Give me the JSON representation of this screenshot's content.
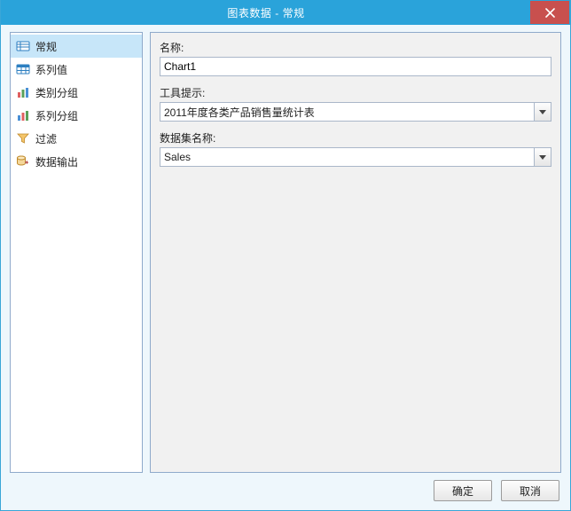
{
  "window": {
    "title": "图表数据 - 常规",
    "close_label": "Close"
  },
  "sidebar": {
    "items": [
      {
        "id": "general",
        "label": "常规",
        "icon": "general-icon",
        "selected": true
      },
      {
        "id": "series-values",
        "label": "系列值",
        "icon": "series-values-icon",
        "selected": false
      },
      {
        "id": "category-groups",
        "label": "类别分组",
        "icon": "category-groups-icon",
        "selected": false
      },
      {
        "id": "series-groups",
        "label": "系列分组",
        "icon": "series-groups-icon",
        "selected": false
      },
      {
        "id": "filters",
        "label": "过滤",
        "icon": "filter-icon",
        "selected": false
      },
      {
        "id": "data-output",
        "label": "数据输出",
        "icon": "data-output-icon",
        "selected": false
      }
    ]
  },
  "main": {
    "name": {
      "label": "名称:",
      "value": "Chart1"
    },
    "tooltip": {
      "label": "工具提示:",
      "value": "2011年度各类产品销售量统计表"
    },
    "dataset": {
      "label": "数据集名称:",
      "value": "Sales"
    }
  },
  "footer": {
    "ok_label": "确定",
    "cancel_label": "取消"
  }
}
